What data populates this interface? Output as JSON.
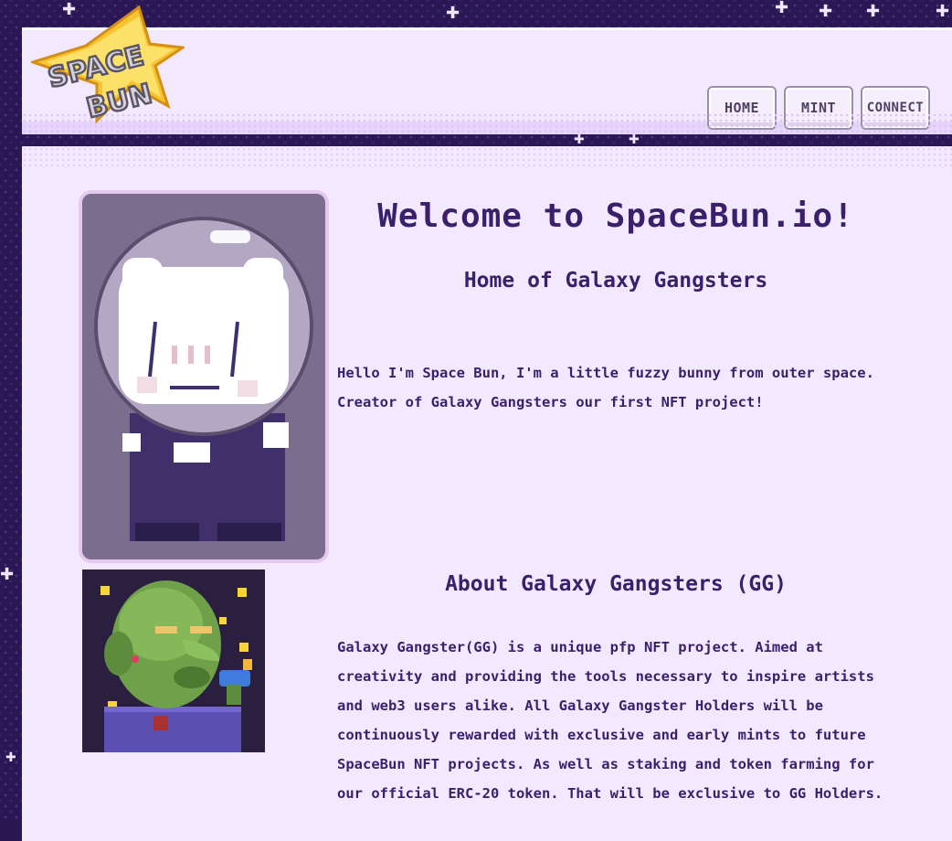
{
  "header": {
    "logo_text": "SPACE BUN",
    "nav": [
      {
        "label": "HOME"
      },
      {
        "label": "MINT"
      },
      {
        "label": "CONNECT"
      }
    ]
  },
  "main": {
    "title": "Welcome to SpaceBun.io!",
    "subtitle": "Home of Galaxy Gangsters",
    "intro": "Hello I'm Space Bun, I'm a little fuzzy bunny from outer space. Creator of Galaxy Gangsters our first NFT project!",
    "about_title": "About Galaxy Gangsters (GG)",
    "about_text": "Galaxy Gangster(GG) is a unique pfp NFT project. Aimed at creativity and providing the tools necessary to inspire artists and web3 users alike. All Galaxy Gangster Holders will be continuously rewarded with exclusive and early mints to future SpaceBun NFT projects. As well as staking and token farming for our official ERC-20 token. That will be exclusive to GG Holders."
  },
  "colors": {
    "background": "#2b1753",
    "panel": "#f3e9ff",
    "text": "#3a1f6b",
    "logo_star": "#f6c431"
  },
  "icons": [
    "space-bun-logo",
    "sparkle-icon",
    "astronaut-bunny-image",
    "galaxy-gangster-image"
  ]
}
